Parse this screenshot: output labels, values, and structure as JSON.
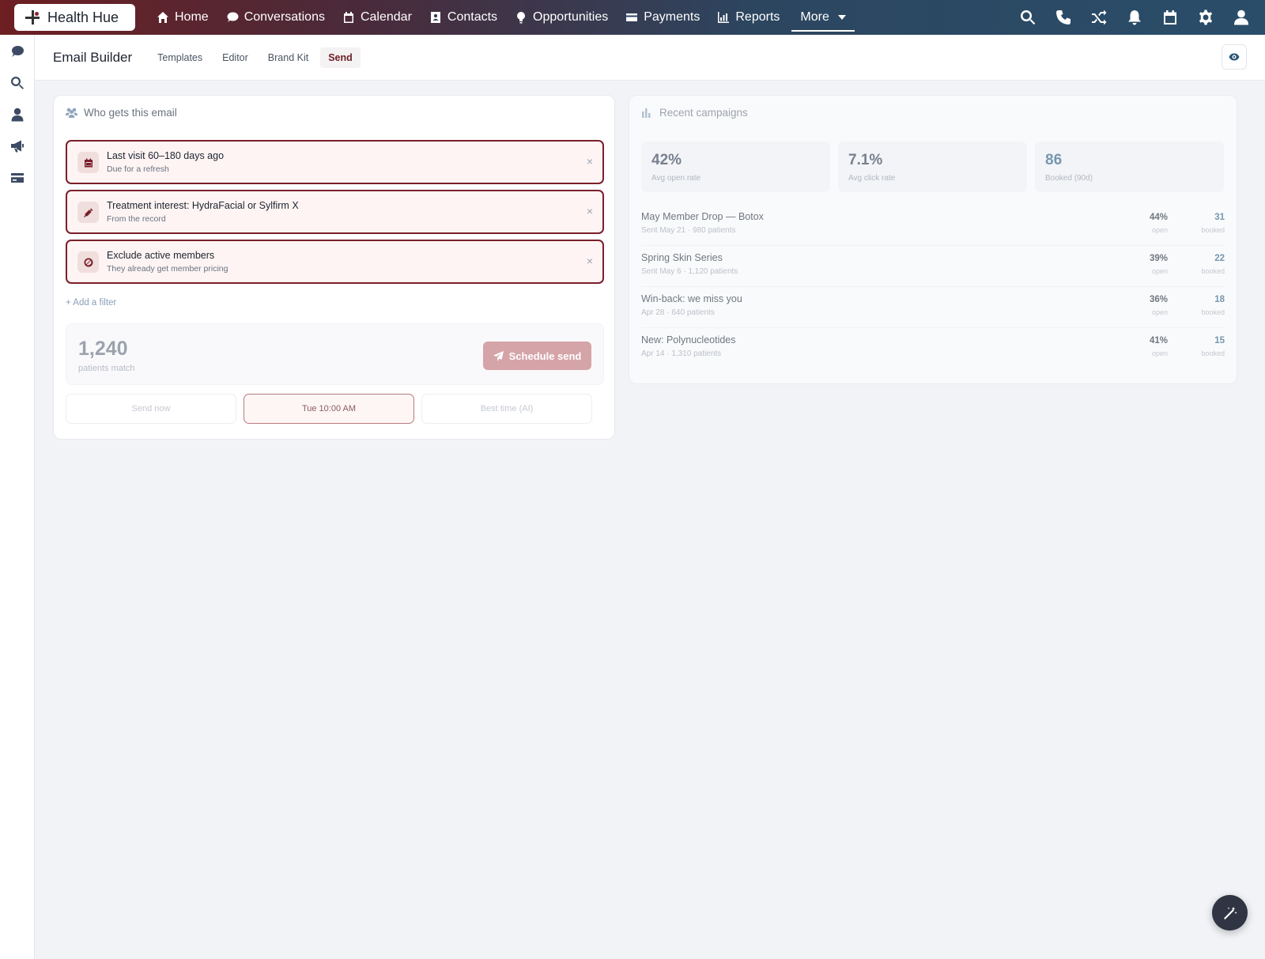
{
  "app": {
    "logo_text": "Health Hue"
  },
  "nav": {
    "items": [
      {
        "label": "Home",
        "icon": "home-icon"
      },
      {
        "label": "Conversations",
        "icon": "chat-icon"
      },
      {
        "label": "Calendar",
        "icon": "calendar-icon"
      },
      {
        "label": "Contacts",
        "icon": "contacts-icon"
      },
      {
        "label": "Opportunities",
        "icon": "lightbulb-icon"
      },
      {
        "label": "Payments",
        "icon": "card-icon"
      },
      {
        "label": "Reports",
        "icon": "chart-icon"
      }
    ],
    "more_label": "More",
    "right_icons": [
      "search-icon",
      "phone-icon",
      "shuffle-icon",
      "bell-icon",
      "calendar-icon",
      "gear-icon",
      "user-icon"
    ]
  },
  "rail": {
    "icons": [
      "chat-icon",
      "search-icon",
      "user-icon",
      "megaphone-icon",
      "card-icon"
    ]
  },
  "subheader": {
    "title": "Email Builder",
    "tabs": [
      {
        "label": "Templates"
      },
      {
        "label": "Editor"
      },
      {
        "label": "Brand Kit"
      },
      {
        "label": "Send"
      }
    ],
    "active_tab": "Send"
  },
  "audience": {
    "title": "Who gets this email",
    "filters": [
      {
        "title": "Last visit 60–180 days ago",
        "sub": "Due for a refresh",
        "icon": "calendar-icon"
      },
      {
        "title": "Treatment interest: HydraFacial or Sylfirm X",
        "sub": "From the record",
        "icon": "syringe-icon"
      },
      {
        "title": "Exclude active members",
        "sub": "They already get member pricing",
        "icon": "ban-icon"
      }
    ],
    "remove_glyph": "×",
    "add_filter": "+ Add a filter",
    "match_count": "1,240",
    "match_label": "patients match",
    "schedule_button": "Schedule send",
    "send_options": [
      "Send now",
      "Tue 10:00 AM",
      "Best time (AI)"
    ],
    "selected_send_option": "Tue 10:00 AM"
  },
  "campaigns": {
    "title": "Recent campaigns",
    "stats": [
      {
        "value": "42%",
        "label": "Avg open rate"
      },
      {
        "value": "7.1%",
        "label": "Avg click rate"
      },
      {
        "value": "86",
        "label": "Booked (90d)"
      }
    ],
    "rows": [
      {
        "name": "May Member Drop — Botox",
        "meta": "Sent May 21 · 980 patients",
        "open": "44%",
        "open_label": "open",
        "booked": "31",
        "booked_label": "booked"
      },
      {
        "name": "Spring Skin Series",
        "meta": "Sent May 6 · 1,120 patients",
        "open": "39%",
        "open_label": "open",
        "booked": "22",
        "booked_label": "booked"
      },
      {
        "name": "Win-back: we miss you",
        "meta": "Apr 28 · 640 patients",
        "open": "36%",
        "open_label": "open",
        "booked": "18",
        "booked_label": "booked"
      },
      {
        "name": "New: Polynucleotides",
        "meta": "Apr 14 · 1,310 patients",
        "open": "41%",
        "open_label": "open",
        "booked": "15",
        "booked_label": "booked"
      }
    ]
  },
  "colors": {
    "brand": "#7a1f2a",
    "accent": "#2a5f86",
    "nav_start": "#6d1f22",
    "nav_end": "#2a4d69"
  }
}
